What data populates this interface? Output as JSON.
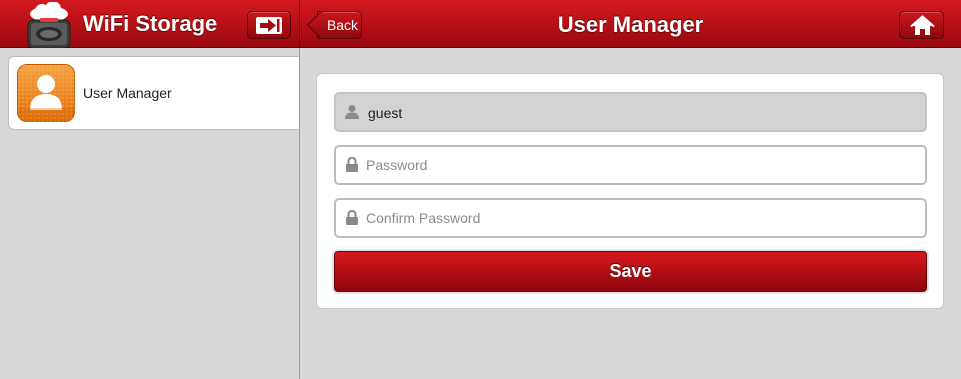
{
  "header": {
    "app_title": "WiFi Storage",
    "back_label": "Back",
    "page_title": "User Manager"
  },
  "sidebar": {
    "items": [
      {
        "label": "User Manager",
        "icon": "user-icon"
      }
    ]
  },
  "form": {
    "username_value": "guest",
    "password_placeholder": "Password",
    "confirm_placeholder": "Confirm Password",
    "save_label": "Save"
  },
  "colors": {
    "accent": "#b50f15",
    "icon_orange": "#ee8a24",
    "background": "#d8d8d8"
  }
}
